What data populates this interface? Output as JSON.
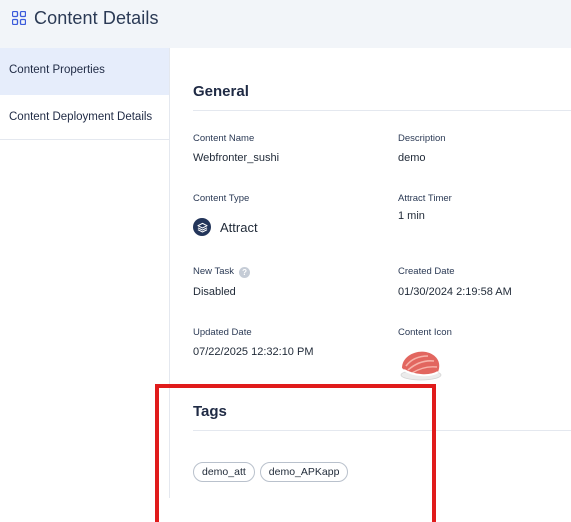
{
  "header": {
    "title": "Content Details",
    "icon": "grid-icon"
  },
  "sidebar": {
    "items": [
      {
        "label": "Content Properties",
        "active": true
      },
      {
        "label": "Content Deployment Details",
        "active": false
      }
    ]
  },
  "general": {
    "title": "General",
    "content_name": {
      "label": "Content Name",
      "value": "Webfronter_sushi"
    },
    "description": {
      "label": "Description",
      "value": "demo"
    },
    "content_type": {
      "label": "Content Type",
      "value": "Attract",
      "icon": "layers-icon"
    },
    "attract_timer": {
      "label": "Attract Timer",
      "value": "1 min"
    },
    "new_task": {
      "label": "New Task",
      "value": "Disabled",
      "icon": "help-icon"
    },
    "created_date": {
      "label": "Created Date",
      "value": "01/30/2024 2:19:58 AM"
    },
    "updated_date": {
      "label": "Updated Date",
      "value": "07/22/2025 12:32:10 PM"
    },
    "content_icon": {
      "label": "Content Icon",
      "icon": "sushi-thumbnail"
    }
  },
  "tags": {
    "title": "Tags",
    "items": [
      "demo_att",
      "demo_APKapp"
    ]
  },
  "colors": {
    "accent": "#23355a",
    "sidebar_active": "#e6edfb",
    "header_bg": "#f2f5f9",
    "highlight": "#e01b1b"
  }
}
